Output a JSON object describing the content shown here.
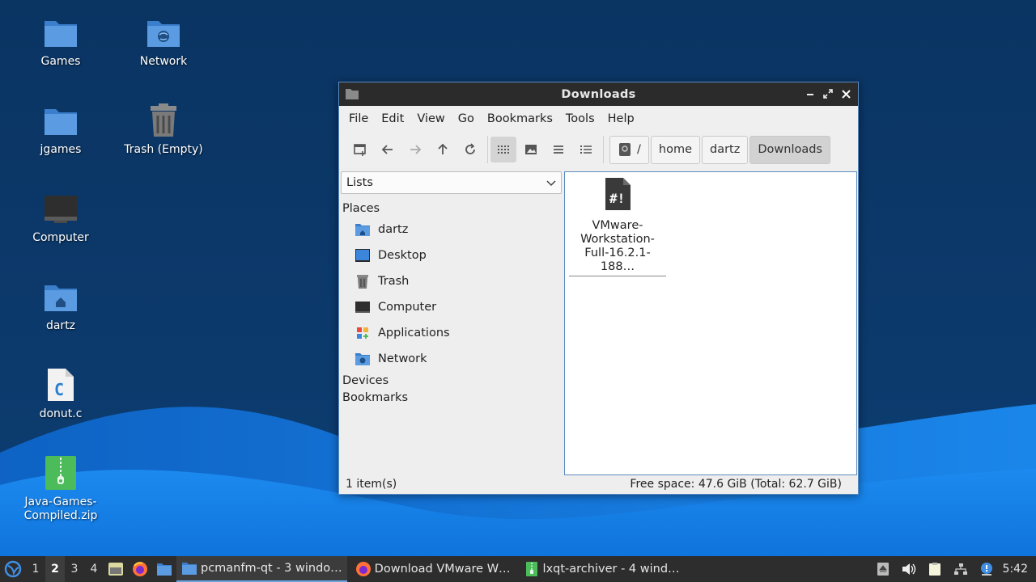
{
  "desktop": {
    "icons": [
      {
        "label": "Games",
        "icon": "folder-icon"
      },
      {
        "label": "Network",
        "icon": "network-folder-icon"
      },
      {
        "label": "jgames",
        "icon": "folder-icon"
      },
      {
        "label": "Trash (Empty)",
        "icon": "trash-icon"
      },
      {
        "label": "Computer",
        "icon": "computer-icon"
      },
      {
        "label": "dartz",
        "icon": "home-folder-icon"
      },
      {
        "label": "donut.c",
        "icon": "c-source-file-icon"
      },
      {
        "label": "Java-Games-\nCompiled.zip",
        "icon": "zip-archive-icon"
      }
    ]
  },
  "window": {
    "title": "Downloads",
    "menu": [
      "File",
      "Edit",
      "View",
      "Go",
      "Bookmarks",
      "Tools",
      "Help"
    ],
    "breadcrumb": [
      "/",
      "home",
      "dartz",
      "Downloads"
    ],
    "sidebar": {
      "selector_value": "Lists",
      "places_heading": "Places",
      "places": [
        {
          "label": "dartz",
          "icon": "home-folder-icon"
        },
        {
          "label": "Desktop",
          "icon": "desktop-icon"
        },
        {
          "label": "Trash",
          "icon": "trash-icon"
        },
        {
          "label": "Computer",
          "icon": "computer-icon"
        },
        {
          "label": "Applications",
          "icon": "applications-icon"
        },
        {
          "label": "Network",
          "icon": "network-icon"
        }
      ],
      "devices_heading": "Devices",
      "bookmarks_heading": "Bookmarks"
    },
    "files": [
      {
        "name": "VMware-\nWorkstation-\nFull-16.2.1-188…",
        "icon": "executable-file-icon"
      }
    ],
    "status": {
      "item_count": "1 item(s)",
      "free_space": "Free space: 47.6 GiB (Total: 62.7 GiB)"
    }
  },
  "taskbar": {
    "workspaces": [
      "1",
      "2",
      "3",
      "4"
    ],
    "active_workspace": "2",
    "tasks": [
      {
        "label": "pcmanfm-qt - 3 windo…",
        "icon": "folder-icon"
      },
      {
        "label": "Download VMware W…",
        "icon": "firefox-icon"
      },
      {
        "label": "lxqt-archiver - 4 wind…",
        "icon": "archive-icon"
      }
    ],
    "clock": "5:42"
  },
  "colors": {
    "wallpaper_dark": "#0b3563",
    "wallpaper_light": "#1e8ff0",
    "folder_blue": "#4a8fd6",
    "taskbar": "#2d2d2d",
    "titlebar": "#2b2b2b"
  }
}
